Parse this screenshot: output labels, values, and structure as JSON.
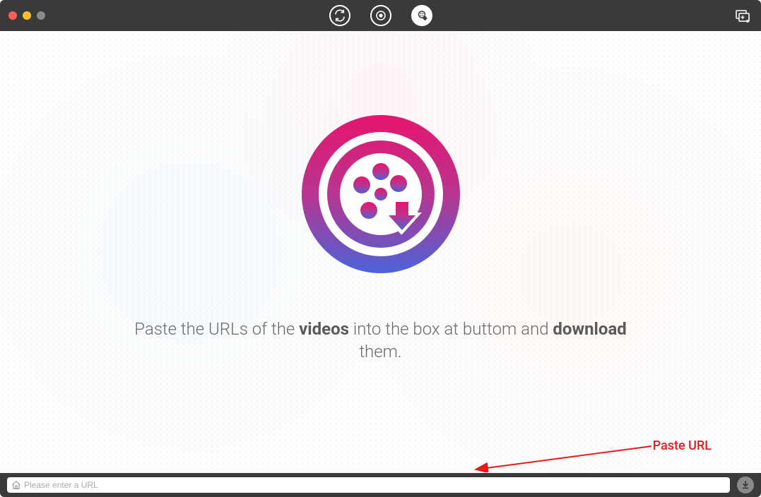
{
  "titlebar": {
    "tabs": [
      {
        "id": "convert",
        "label": "Convert",
        "icon": "convert-icon",
        "active": false
      },
      {
        "id": "rip",
        "label": "Rip",
        "icon": "rip-icon",
        "active": false
      },
      {
        "id": "download",
        "label": "Download",
        "icon": "download-icon",
        "active": true
      }
    ]
  },
  "main": {
    "instruction_parts": {
      "prefix": "Paste the URLs of the ",
      "bold1": "videos",
      "mid": " into the box at buttom and ",
      "bold2": "download",
      "suffix": " them."
    }
  },
  "annotation": {
    "paste_label": "Paste URL"
  },
  "bottombar": {
    "url_placeholder": "Please enter a URL",
    "url_value": ""
  },
  "colors": {
    "annotation_red": "#e21b1b",
    "titlebar_bg": "#3a3a3a",
    "logo_gradient_top": "#e7156e",
    "logo_gradient_bottom": "#4b63d8"
  }
}
